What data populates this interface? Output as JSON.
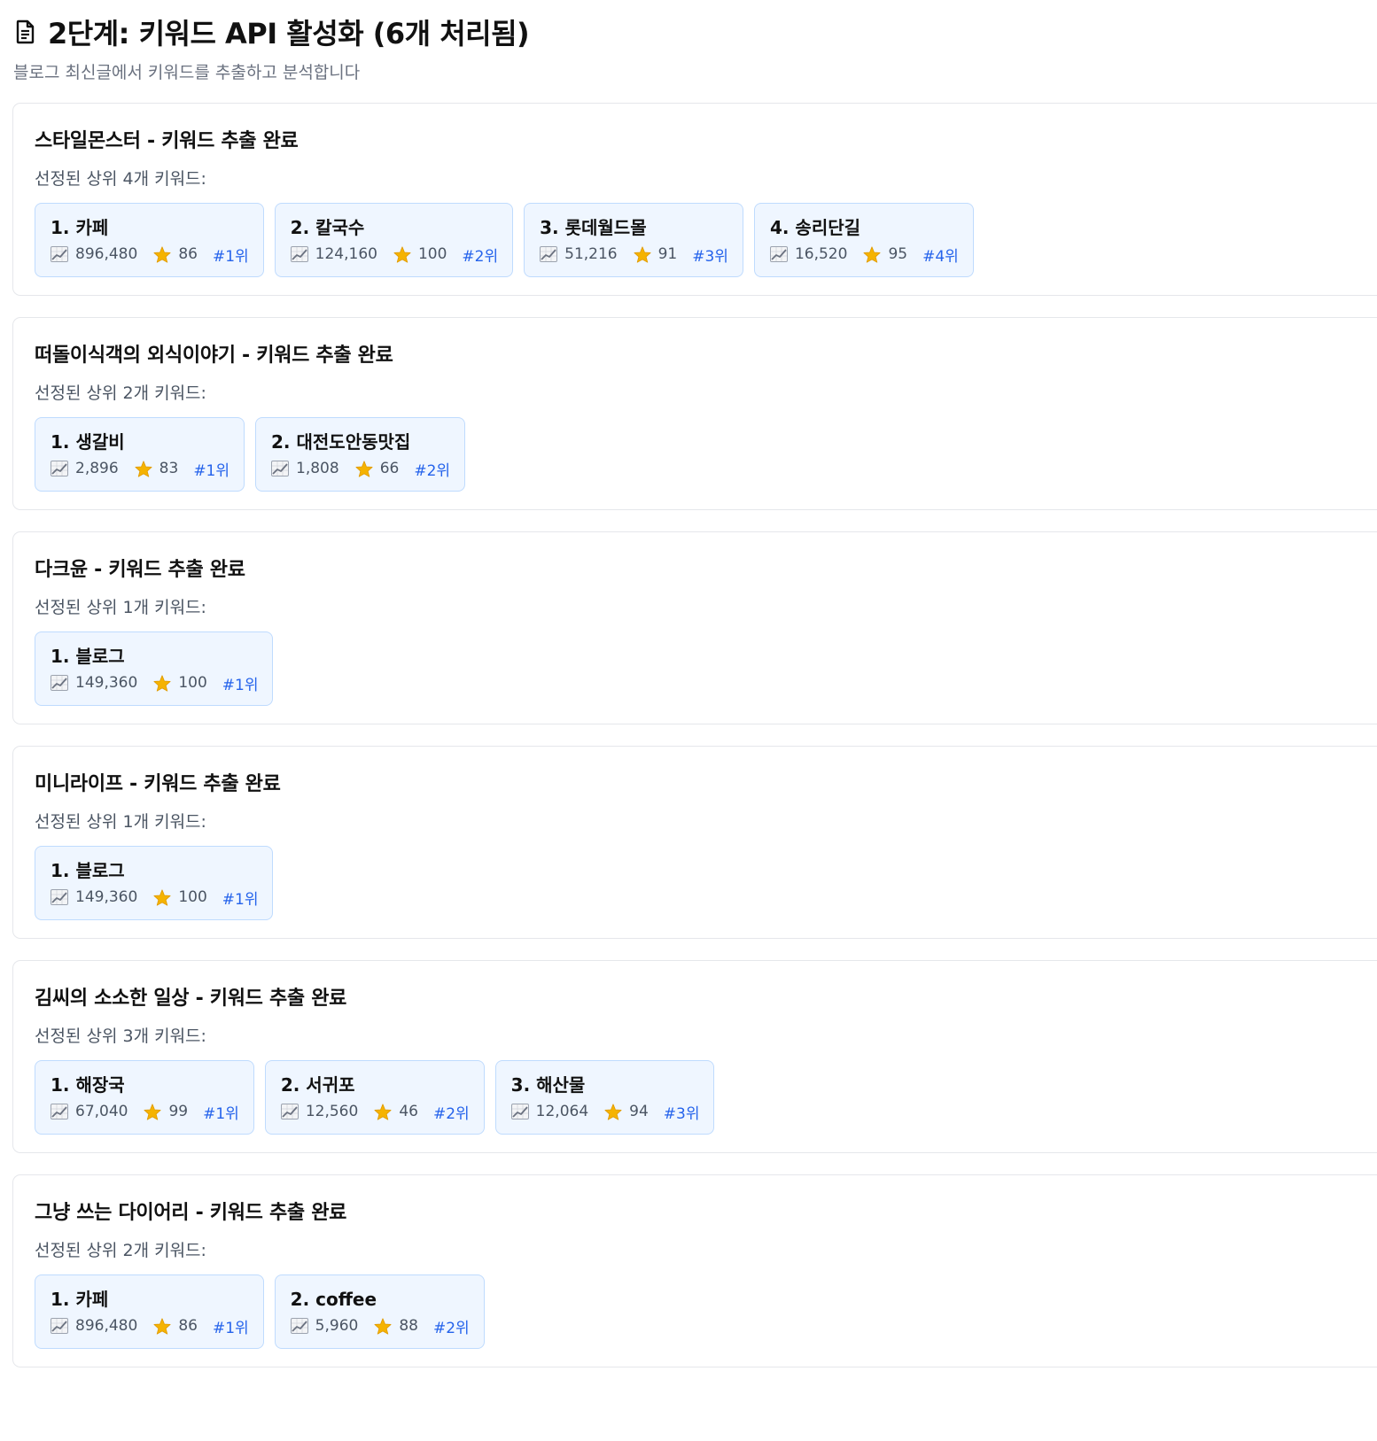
{
  "header": {
    "title": "2단계: 키워드 API 활성화 (6개 처리됨)",
    "subtitle": "블로그 최신글에서 키워드를 추출하고 분석합니다",
    "icon": "document-icon"
  },
  "sections": [
    {
      "title": "스타일몬스터 - 키워드 추출 완료",
      "label": "선정된 상위 4개 키워드:",
      "keywords": [
        {
          "name": "1. 카페",
          "volume": "896,480",
          "score": "86",
          "rank": "#1위"
        },
        {
          "name": "2. 칼국수",
          "volume": "124,160",
          "score": "100",
          "rank": "#2위"
        },
        {
          "name": "3. 롯데월드몰",
          "volume": "51,216",
          "score": "91",
          "rank": "#3위"
        },
        {
          "name": "4. 송리단길",
          "volume": "16,520",
          "score": "95",
          "rank": "#4위"
        }
      ]
    },
    {
      "title": "떠돌이식객의 외식이야기 - 키워드 추출 완료",
      "label": "선정된 상위 2개 키워드:",
      "keywords": [
        {
          "name": "1. 생갈비",
          "volume": "2,896",
          "score": "83",
          "rank": "#1위"
        },
        {
          "name": "2. 대전도안동맛집",
          "volume": "1,808",
          "score": "66",
          "rank": "#2위"
        }
      ]
    },
    {
      "title": "다크윤 - 키워드 추출 완료",
      "label": "선정된 상위 1개 키워드:",
      "keywords": [
        {
          "name": "1. 블로그",
          "volume": "149,360",
          "score": "100",
          "rank": "#1위"
        }
      ]
    },
    {
      "title": "미니라이프 - 키워드 추출 완료",
      "label": "선정된 상위 1개 키워드:",
      "keywords": [
        {
          "name": "1. 블로그",
          "volume": "149,360",
          "score": "100",
          "rank": "#1위"
        }
      ]
    },
    {
      "title": "김씨의 소소한 일상 - 키워드 추출 완료",
      "label": "선정된 상위 3개 키워드:",
      "keywords": [
        {
          "name": "1. 해장국",
          "volume": "67,040",
          "score": "99",
          "rank": "#1위"
        },
        {
          "name": "2. 서귀포",
          "volume": "12,560",
          "score": "46",
          "rank": "#2위"
        },
        {
          "name": "3. 해산물",
          "volume": "12,064",
          "score": "94",
          "rank": "#3위"
        }
      ]
    },
    {
      "title": "그냥 쓰는 다이어리 - 키워드 추출 완료",
      "label": "선정된 상위 2개 키워드:",
      "keywords": [
        {
          "name": "1. 카페",
          "volume": "896,480",
          "score": "86",
          "rank": "#1위"
        },
        {
          "name": "2. coffee",
          "volume": "5,960",
          "score": "88",
          "rank": "#2위"
        }
      ]
    }
  ],
  "icons": {
    "volume": "chart-increasing-icon",
    "score": "star-icon"
  },
  "colors": {
    "card_bg": "#eff6ff",
    "card_border": "#bfdbfe",
    "rank": "#2563eb",
    "star": "#f5b301"
  }
}
